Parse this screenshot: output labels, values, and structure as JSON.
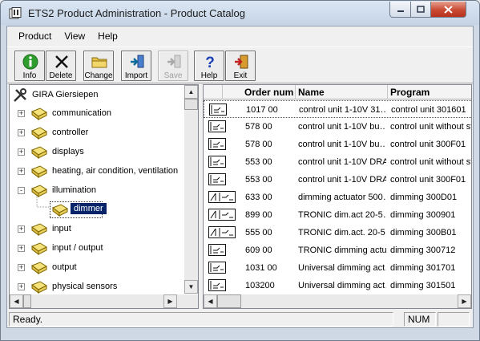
{
  "window": {
    "title": "ETS2 Product Administration - Product Catalog",
    "minimize_icon": "minimize-icon",
    "maximize_icon": "maximize-icon",
    "close_icon": "close-icon"
  },
  "menu": [
    "Product",
    "View",
    "Help"
  ],
  "toolbar": [
    {
      "label": "Info",
      "icon": "info-icon",
      "enabled": true
    },
    {
      "label": "Delete",
      "icon": "delete-icon",
      "enabled": true
    },
    {
      "label": "Change",
      "icon": "folder-icon",
      "enabled": true
    },
    {
      "label": "Import",
      "icon": "import-icon",
      "enabled": true
    },
    {
      "label": "Save",
      "icon": "save-icon",
      "enabled": false
    },
    {
      "label": "Help",
      "icon": "help-icon",
      "enabled": true
    },
    {
      "label": "Exit",
      "icon": "exit-icon",
      "enabled": true
    }
  ],
  "tree": {
    "root": "GIRA Giersiepen",
    "items": [
      {
        "label": "communication",
        "expander": "+"
      },
      {
        "label": "controller",
        "expander": "+"
      },
      {
        "label": "displays",
        "expander": "+"
      },
      {
        "label": "heating, air condition, ventilation",
        "expander": "+"
      },
      {
        "label": "illumination",
        "expander": "-"
      },
      {
        "label": "dimmer",
        "expander": "",
        "selected": true
      },
      {
        "label": "input",
        "expander": "+"
      },
      {
        "label": "input / output",
        "expander": "+"
      },
      {
        "label": "output",
        "expander": "+"
      },
      {
        "label": "physical sensors",
        "expander": "+"
      }
    ]
  },
  "table": {
    "columns": [
      "Order num",
      "Name",
      "Program"
    ],
    "rows": [
      {
        "order": "1017 00",
        "name": "control unit 1-10V 31…",
        "program": "control unit 301601",
        "selected": true
      },
      {
        "order": "578 00",
        "name": "control unit 1-10V bu…",
        "program": "control unit without st"
      },
      {
        "order": "578 00",
        "name": "control unit 1-10V bu…",
        "program": "control unit 300F01"
      },
      {
        "order": "553 00",
        "name": "control unit 1-10V DRA",
        "program": "control unit without st"
      },
      {
        "order": "553 00",
        "name": "control unit 1-10V DRA",
        "program": "control unit 300F01"
      },
      {
        "order": "633 00",
        "name": "dimming actuator 500…",
        "program": "dimming 300D01"
      },
      {
        "order": "899 00",
        "name": "TRONIC dim.act 20-5…",
        "program": "dimming 300901"
      },
      {
        "order": "555 00",
        "name": "TRONIC dim.act. 20-5…",
        "program": "dimming 300B01"
      },
      {
        "order": "609 00",
        "name": "TRONIC dimming actu…",
        "program": "dimming 300712"
      },
      {
        "order": "1031 00",
        "name": "Universal dimming act…",
        "program": "dimming 301701"
      },
      {
        "order": "103200",
        "name": "Universal dimming act…",
        "program": "dimming 301501"
      }
    ]
  },
  "status": {
    "text": "Ready.",
    "num": "NUM"
  },
  "colors": {
    "selection": "#0a246a",
    "accent": "#2a5fb0"
  }
}
